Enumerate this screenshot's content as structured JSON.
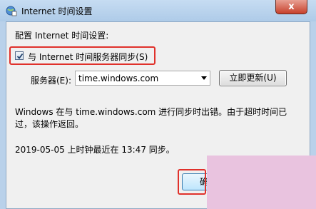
{
  "window": {
    "title": "Internet 时间设置",
    "close_label": "x"
  },
  "dialog": {
    "heading": "配置 Internet 时间设置:",
    "sync_checkbox": {
      "label": "与 Internet 时间服务器同步(S)",
      "checked": true
    },
    "server": {
      "label": "服务器(E):",
      "value": "time.windows.com"
    },
    "update_button": "立即更新(U)",
    "error_message": "Windows 在与 time.windows.com 进行同步时出错。由于超时时间已过，该操作返回。",
    "last_sync": "2019-05-05 上时钟最近在 13:47 同步。",
    "ok_button": "确"
  },
  "colors": {
    "highlight": "#e0312b",
    "watermark": "#e9c3df"
  }
}
